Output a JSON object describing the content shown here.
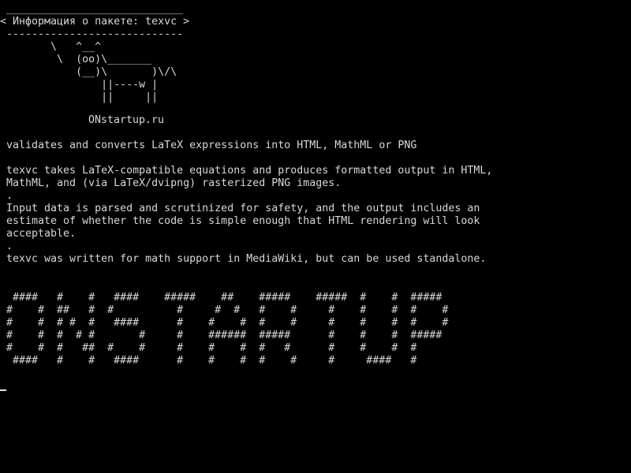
{
  "colors": {
    "background": "#000000",
    "foreground": "#d8d8d8"
  },
  "bubble": {
    "text": " ____________________________\n< Информация о пакете: texvc >\n ----------------------------"
  },
  "cow": {
    "art": "        \\   ^__^\n         \\  (oo)\\_______\n            (__)\\       )\\/\\\n                ||----w |\n                ||     ||"
  },
  "brand": {
    "name": "ONstartup.ru"
  },
  "package": {
    "summary": "validates and converts LaTeX expressions into HTML, MathML or PNG",
    "description": "texvc takes LaTeX-compatible equations and produces formatted output in HTML,\nMathML, and (via LaTeX/dvipng) rasterized PNG images.\n.\nInput data is parsed and scrutinized for safety, and the output includes an\nestimate of whether the code is simple enough that HTML rendering will look\nacceptable.\n.\ntexvc was written for math support in MediaWiki, but can be used standalone."
  },
  "banner": {
    "art": " ####   #    #   ####    #####    ##    #####    #####  #    #  #####\n#    #  ##   #  #          #     #  #   #    #     #    #    #  #    #\n#    #  # #  #   ####      #    #    #  #    #     #    #    #  #    #\n#    #  #  # #       #     #    ######  #####      #    #    #  #####\n#    #  #   ##  #    #     #    #    #  #   #      #    #    #  #\n ####   #    #   ####      #    #    #  #    #     #     ####   #"
  }
}
